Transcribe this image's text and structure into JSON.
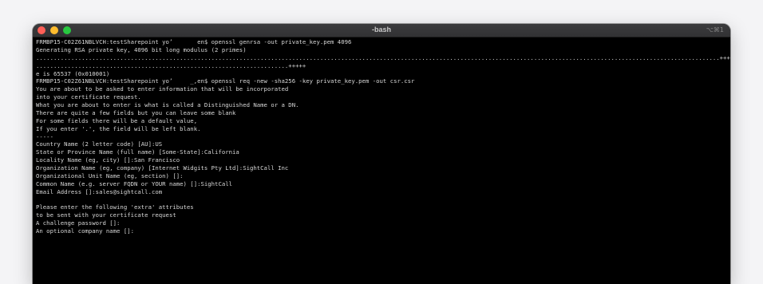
{
  "window": {
    "title": "-bash",
    "shortcut": "⌥⌘1",
    "traffic_lights": {
      "close": "#ff5f57",
      "minimize": "#febc2e",
      "zoom": "#28c840"
    }
  },
  "terminal": {
    "text_color": "#d7d7d7",
    "background": "#000000",
    "lines": [
      "FRMBP15-C02Z61NBLVCH:testSharepoint yo’       en$ openssl genrsa -out private_key.pem 4096",
      "Generating RSA private key, 4096 bit long modulus (2 primes)",
      "...................................................................................................................................................................................................+++++",
      "........................................................................+++++",
      "e is 65537 (0x010001)",
      "FRMBP15-C02Z61NBLVCH:testSharepoint yo’     _,en$ openssl req -new -sha256 -key private_key.pem -out csr.csr",
      "You are about to be asked to enter information that will be incorporated",
      "into your certificate request.",
      "What you are about to enter is what is called a Distinguished Name or a DN.",
      "There are quite a few fields but you can leave some blank",
      "For some fields there will be a default value,",
      "If you enter '.', the field will be left blank.",
      "-----",
      "Country Name (2 letter code) [AU]:US",
      "State or Province Name (full name) [Some-State]:California",
      "Locality Name (eg, city) []:San Francisco",
      "Organization Name (eg, company) [Internet Widgits Pty Ltd]:SightCall Inc",
      "Organizational Unit Name (eg, section) []:",
      "Common Name (e.g. server FQDN or YOUR name) []:SightCall",
      "Email Address []:sales@sightcall.com",
      "",
      "Please enter the following 'extra' attributes",
      "to be sent with your certificate request",
      "A challenge password []:",
      "An optional company name []:"
    ]
  }
}
